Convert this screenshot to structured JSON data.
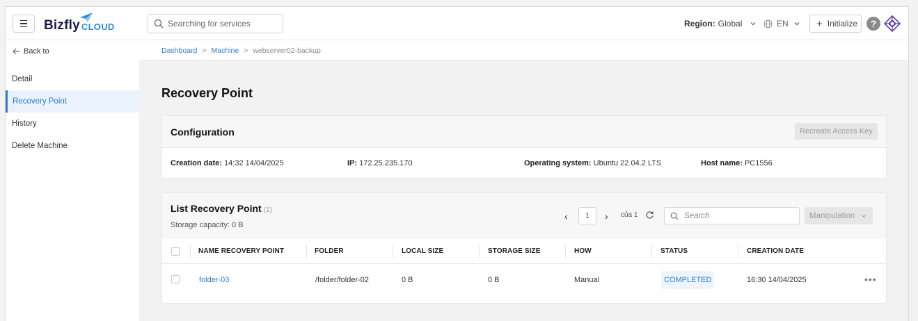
{
  "header": {
    "logo_main": "Bizfly",
    "logo_cloud": "CLOUD",
    "search_placeholder": "Searching for services",
    "region_label": "Region:",
    "region_value": "Global",
    "language": "EN",
    "initialize_label": "Initialize",
    "help_label": "?"
  },
  "sidebar": {
    "back_label": "Back to",
    "items": [
      {
        "label": "Detail"
      },
      {
        "label": "Recovery Point"
      },
      {
        "label": "History"
      },
      {
        "label": "Delete Machine"
      }
    ],
    "active_index": 1
  },
  "breadcrumb": {
    "items": [
      "Dashboard",
      "Machine",
      "webserver02-backup"
    ],
    "separator": ">"
  },
  "page_title": "Recovery Point",
  "configuration": {
    "title": "Configuration",
    "recreate_label": "Recreate Access Key",
    "creation_date_label": "Creation date:",
    "creation_date_value": "14:32 14/04/2025",
    "ip_label": "IP:",
    "ip_value": "172.25.235.170",
    "os_label": "Operating system:",
    "os_value": "Ubuntu 22.04.2 LTS",
    "host_label": "Host name:",
    "host_value": "PC1556"
  },
  "recovery_list": {
    "title": "List Recovery Point",
    "count": "(1)",
    "storage": "Storage capacity: 0 B",
    "pager": {
      "prev": "‹",
      "page": "1",
      "next": "›",
      "of": "của 1"
    },
    "search_placeholder": "Search",
    "manipulation_label": "Manipulation",
    "columns": [
      "NAME RECOVERY POINT",
      "FOLDER",
      "LOCAL SIZE",
      "STORAGE SIZE",
      "HOW",
      "STATUS",
      "CREATION DATE"
    ],
    "rows": [
      {
        "name": "folder-03",
        "folder": "/folder/folder-02",
        "local_size": "0 B",
        "storage_size": "0 B",
        "how": "Manual",
        "status": "COMPLETED",
        "created": "16:30 14/04/2025",
        "more": "•••"
      }
    ]
  },
  "colors": {
    "accent": "#2f7bd6",
    "brand_dark": "#1c1b4f",
    "brand_cloud": "#2f8be0"
  }
}
